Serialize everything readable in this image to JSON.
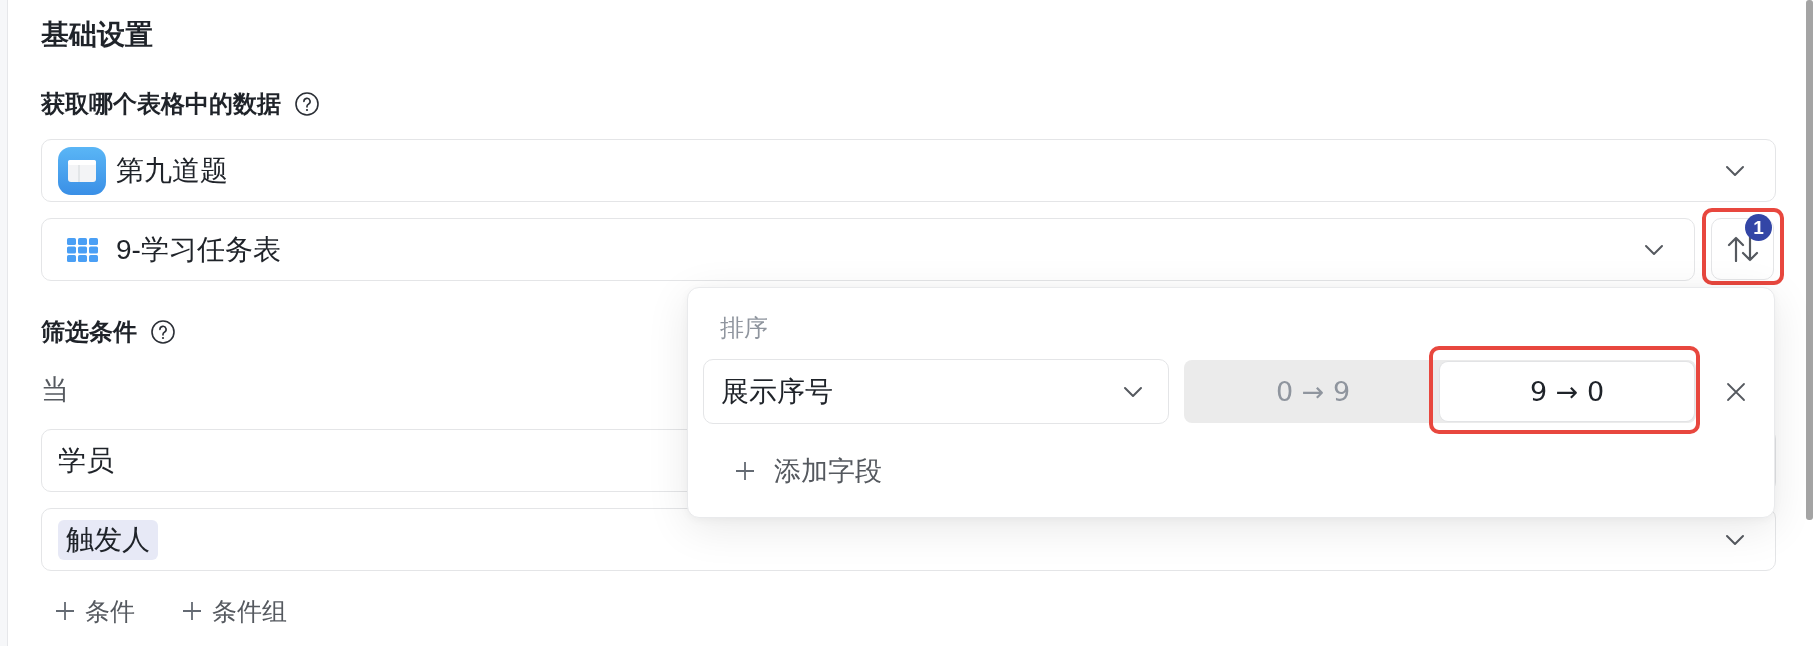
{
  "section_title": "基础设置",
  "source": {
    "label": "获取哪个表格中的数据",
    "base": {
      "name": "第九道题"
    },
    "table": {
      "name": "9-学习任务表"
    },
    "sort_button": {
      "badge": "1",
      "highlighted": true
    }
  },
  "sort_popover": {
    "title": "排序",
    "rules": [
      {
        "field": "展示序号",
        "orders": [
          {
            "label": "0 → 9",
            "selected": false,
            "highlighted": false
          },
          {
            "label": "9 → 0",
            "selected": true,
            "highlighted": true
          }
        ]
      }
    ],
    "add_label": "添加字段"
  },
  "filter": {
    "label": "筛选条件",
    "when": "当",
    "field": "学员",
    "value_tags": [
      "触发人"
    ],
    "add_buttons": [
      "条件",
      "条件组"
    ]
  }
}
